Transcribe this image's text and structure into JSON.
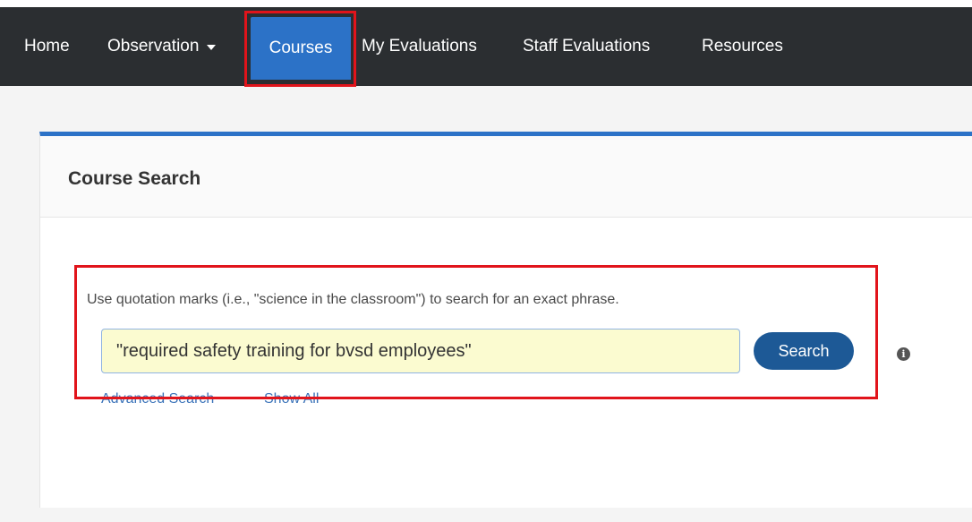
{
  "nav": {
    "home": "Home",
    "observation": "Observation",
    "courses": "Courses",
    "my_evaluations": "My Evaluations",
    "staff_evaluations": "Staff Evaluations",
    "resources": "Resources",
    "active_color": "#2c72c7"
  },
  "panel": {
    "title": "Course Search",
    "accent_color": "#2c72c7"
  },
  "search": {
    "hint": "Use quotation marks (i.e., \"science in the classroom\") to search for an exact phrase.",
    "value": "\"required safety training for bvsd employees\"",
    "button_label": "Search",
    "info_icon": "info-icon",
    "advanced_link": "Advanced Search",
    "show_all_link": "Show All"
  },
  "highlight_color": "#e1141b"
}
